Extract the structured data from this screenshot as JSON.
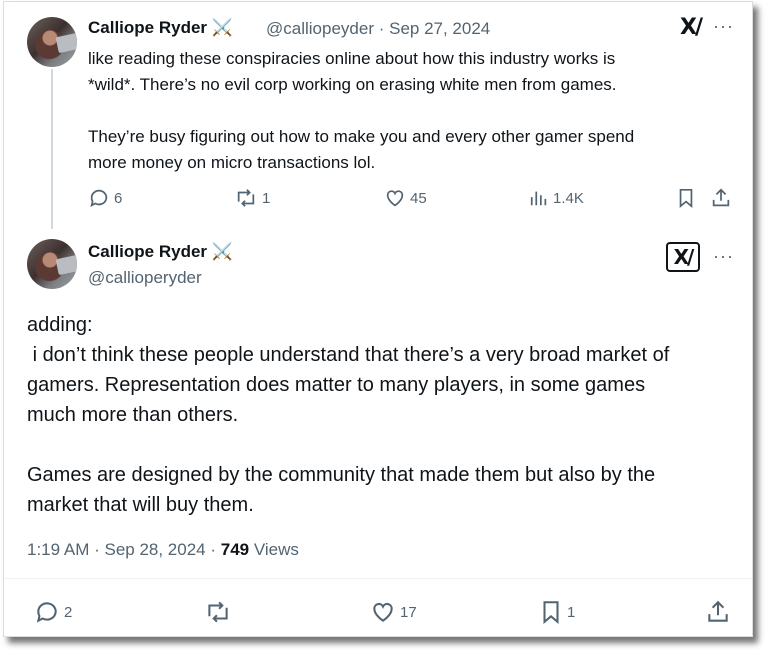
{
  "reply_tweet": {
    "author_name": "Calliope Ryder",
    "author_emoji": "⚔️",
    "handle": "@calliopeyder",
    "date": "· Sep 27, 2024",
    "grok_label": "X/",
    "text": "like reading these conspiracies online about how this industry works is\n*wild*. There’s no evil corp working on erasing white men from games.\n\nThey’re busy figuring out how to make you and every other gamer spend\nmore money on micro transactions lol.",
    "actions": {
      "replies": "6",
      "reposts": "1",
      "likes": "45",
      "views": "1.4K"
    }
  },
  "main_tweet": {
    "author_name": "Calliope Ryder",
    "author_emoji": "⚔️",
    "handle": "@callioperyder",
    "grok_label": "X/",
    "text": "adding:\n i don’t think these people understand that there’s a very broad market of\ngamers. Representation does matter to many players, in some games\nmuch more than others.\n\nGames are designed by the community that made them but also by the\nmarket that will buy them.",
    "time": "1:19 AM · Sep 28, 2024 · ",
    "views_count": "749",
    "views_label": " Views",
    "actions": {
      "replies": "2",
      "reposts": "",
      "likes": "17",
      "bookmarks": "1"
    }
  },
  "more_label": "···"
}
